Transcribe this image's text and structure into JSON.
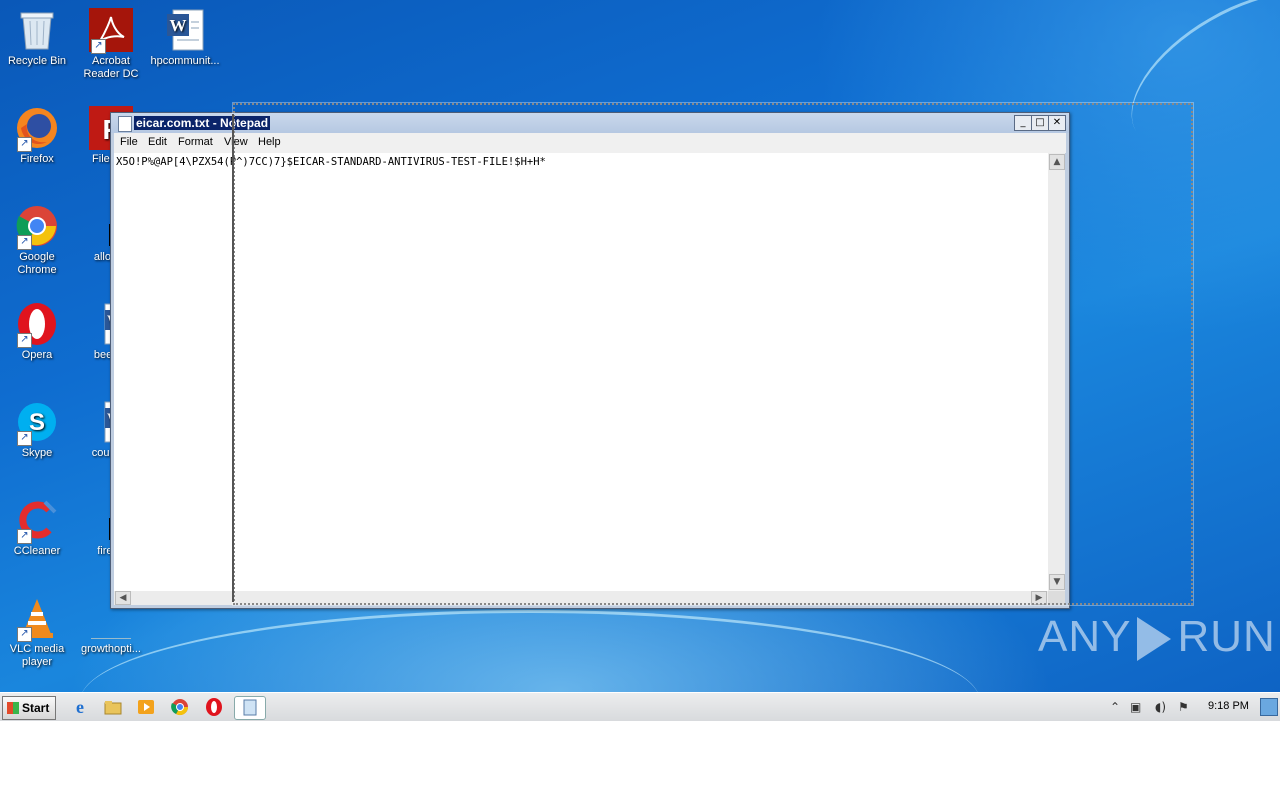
{
  "desktop": {
    "icons_col1": [
      {
        "label": "Recycle Bin",
        "name": "recycle-bin-icon"
      },
      {
        "label": "Firefox",
        "name": "firefox-icon"
      },
      {
        "label": "Google Chrome",
        "name": "chrome-icon"
      },
      {
        "label": "Opera",
        "name": "opera-icon"
      },
      {
        "label": "Skype",
        "name": "skype-icon"
      },
      {
        "label": "CCleaner",
        "name": "ccleaner-icon"
      },
      {
        "label": "VLC media player",
        "name": "vlc-icon"
      }
    ],
    "icons_col2": [
      {
        "label": "Acrobat Reader DC",
        "name": "acrobat-icon"
      },
      {
        "label": "FileZilla",
        "name": "filezilla-icon"
      },
      {
        "label": "allowth",
        "name": "file-icon"
      },
      {
        "label": "beenpr",
        "name": "word-doc-icon"
      },
      {
        "label": "courses",
        "name": "word-doc-icon"
      },
      {
        "label": "firego",
        "name": "file-icon"
      },
      {
        "label": "growthopti...",
        "name": "file-icon"
      }
    ],
    "icons_col3": [
      {
        "label": "hpcommunit...",
        "name": "word-doc-icon"
      }
    ]
  },
  "notepad": {
    "title": "eicar.com.txt - Notepad",
    "menu": [
      "File",
      "Edit",
      "Format",
      "View",
      "Help"
    ],
    "content": "X5O!P%@AP[4\\PZX54(P^)7CC)7}$EICAR-STANDARD-ANTIVIRUS-TEST-FILE!$H+H*",
    "buttons": {
      "minimize": "_",
      "maximize": "□",
      "close": "✕"
    }
  },
  "watermark": {
    "left": "ANY",
    "right": "RUN"
  },
  "taskbar": {
    "start_label": "Start",
    "clock": "9:18 PM"
  },
  "colors": {
    "accent": "#0a246a",
    "desktop": "#0f6dd0"
  }
}
